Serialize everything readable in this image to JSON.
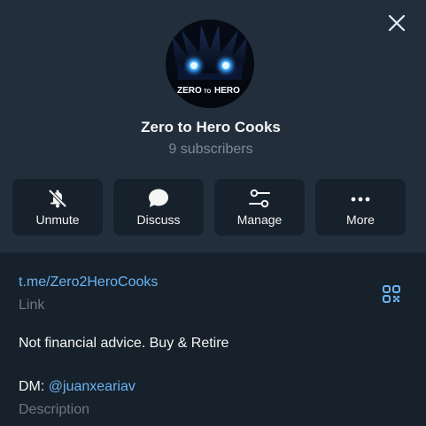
{
  "channel": {
    "name": "Zero to Hero Cooks",
    "subscribers": "9 subscribers",
    "avatar_text_left": "ZERO",
    "avatar_text_mid": "TO",
    "avatar_text_right": "HERO"
  },
  "actions": [
    {
      "label": "Unmute",
      "icon": "bell-off-icon"
    },
    {
      "label": "Discuss",
      "icon": "chat-bubble-icon"
    },
    {
      "label": "Manage",
      "icon": "sliders-icon"
    },
    {
      "label": "More",
      "icon": "more-dots-icon"
    }
  ],
  "info": {
    "link": "t.me/Zero2HeroCooks",
    "link_label": "Link",
    "description_line1": "Not financial advice. Buy & Retire",
    "description_dm_prefix": "DM: ",
    "description_mention": "@juanxeariav",
    "description_label": "Description"
  },
  "colors": {
    "background": "#17212b",
    "header": "#232e3c",
    "accent": "#6ab3f3",
    "muted": "#7d8b99"
  }
}
